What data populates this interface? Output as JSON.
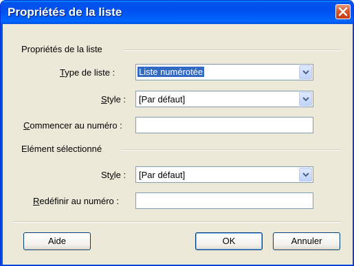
{
  "window": {
    "title": "Propriétés de la liste"
  },
  "groups": {
    "list": {
      "heading": "Propriétés de la liste"
    },
    "item": {
      "heading": "Elément sélectionné"
    }
  },
  "fields": {
    "list_type": {
      "label_prefix": "",
      "accesskey": "T",
      "label_rest": "ype de liste :",
      "value": "Liste numérotée"
    },
    "list_style": {
      "label_prefix": "",
      "accesskey": "S",
      "label_rest": "tyle :",
      "value": "[Par défaut]"
    },
    "start_number": {
      "label_prefix": "",
      "accesskey": "C",
      "label_rest": "ommencer au numéro :",
      "value": ""
    },
    "item_style": {
      "label_prefix": "St",
      "accesskey": "y",
      "label_rest": "le :",
      "value": "[Par défaut]"
    },
    "reset_number": {
      "label_prefix": "",
      "accesskey": "R",
      "label_rest": "edéfinir au numéro :",
      "value": ""
    }
  },
  "buttons": {
    "help": "Aide",
    "ok": "OK",
    "cancel": "Annuler"
  },
  "icons": {
    "close": "close-icon",
    "dropdown": "chevron-down-icon"
  },
  "colors": {
    "title_bar": "#0054e3",
    "close_button": "#d9562e",
    "selection": "#316ac5",
    "dialog_bg": "#ece9d8"
  }
}
